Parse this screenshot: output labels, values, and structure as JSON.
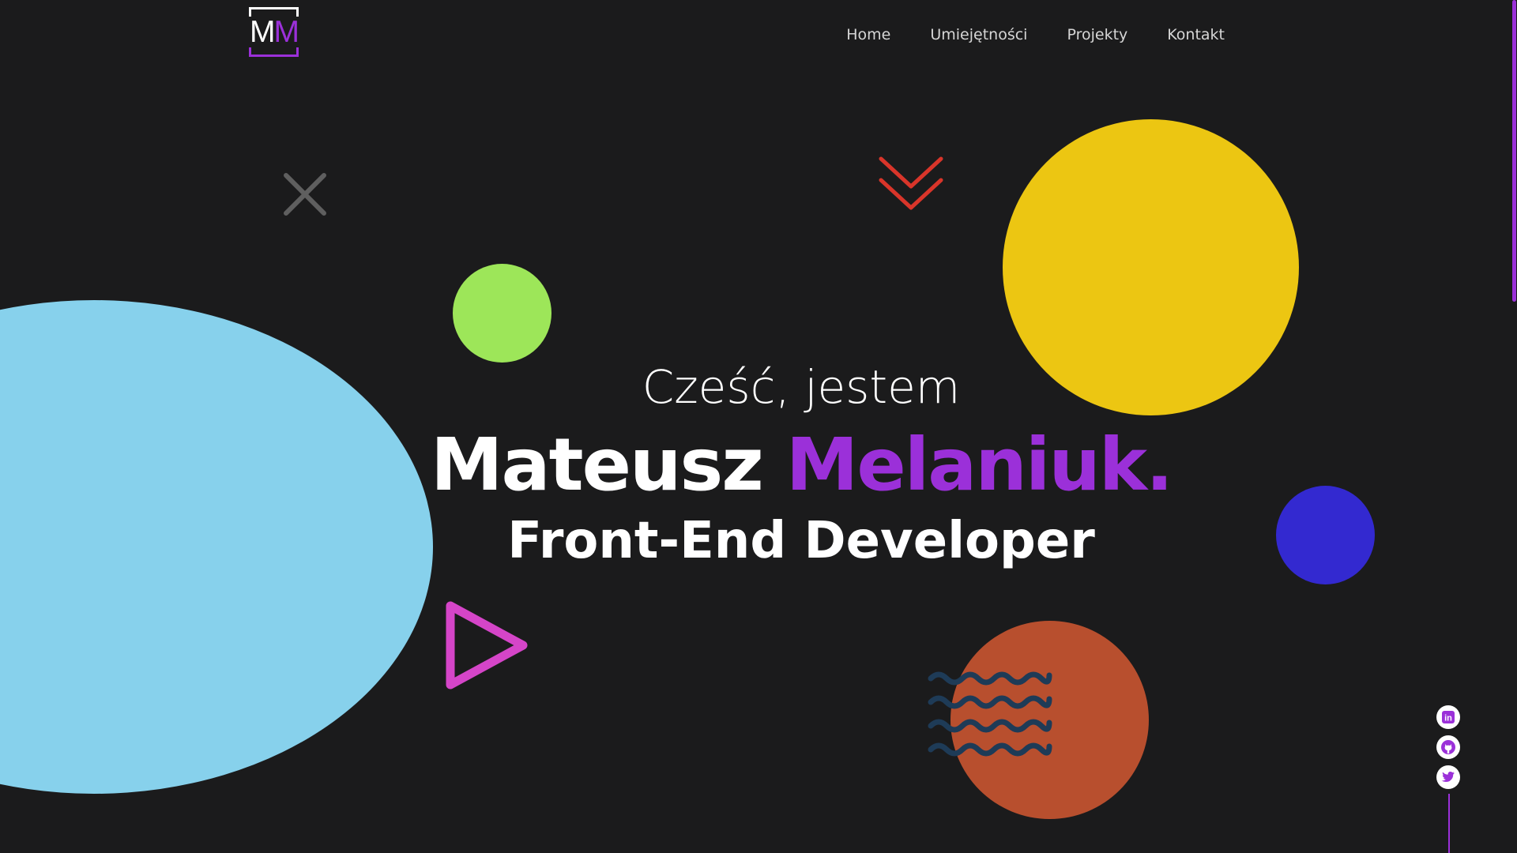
{
  "logo": {
    "letter_first": "M",
    "letter_second": "M"
  },
  "nav": {
    "items": [
      {
        "label": "Home"
      },
      {
        "label": "Umiejętności"
      },
      {
        "label": "Projekty"
      },
      {
        "label": "Kontakt"
      }
    ]
  },
  "hero": {
    "greeting": "Cześć, jestem",
    "first_name": "Mateusz",
    "last_name": "Melaniuk.",
    "role": "Front-End Developer"
  },
  "social": {
    "items": [
      {
        "icon": "linkedin-icon",
        "label": "in"
      },
      {
        "icon": "github-icon"
      },
      {
        "icon": "twitter-icon"
      }
    ]
  },
  "colors": {
    "background": "#1b1b1c",
    "accent": "#9b30d9",
    "circle_blue": "#87d1ec",
    "circle_green": "#9de659",
    "circle_yellow": "#ecc612",
    "circle_indigo": "#3329d0",
    "circle_orange": "#b84f2e",
    "triangle": "#d545c8",
    "chevrons": "#d9352a",
    "cross": "#5f5f5f",
    "waves": "#1e3b57"
  }
}
